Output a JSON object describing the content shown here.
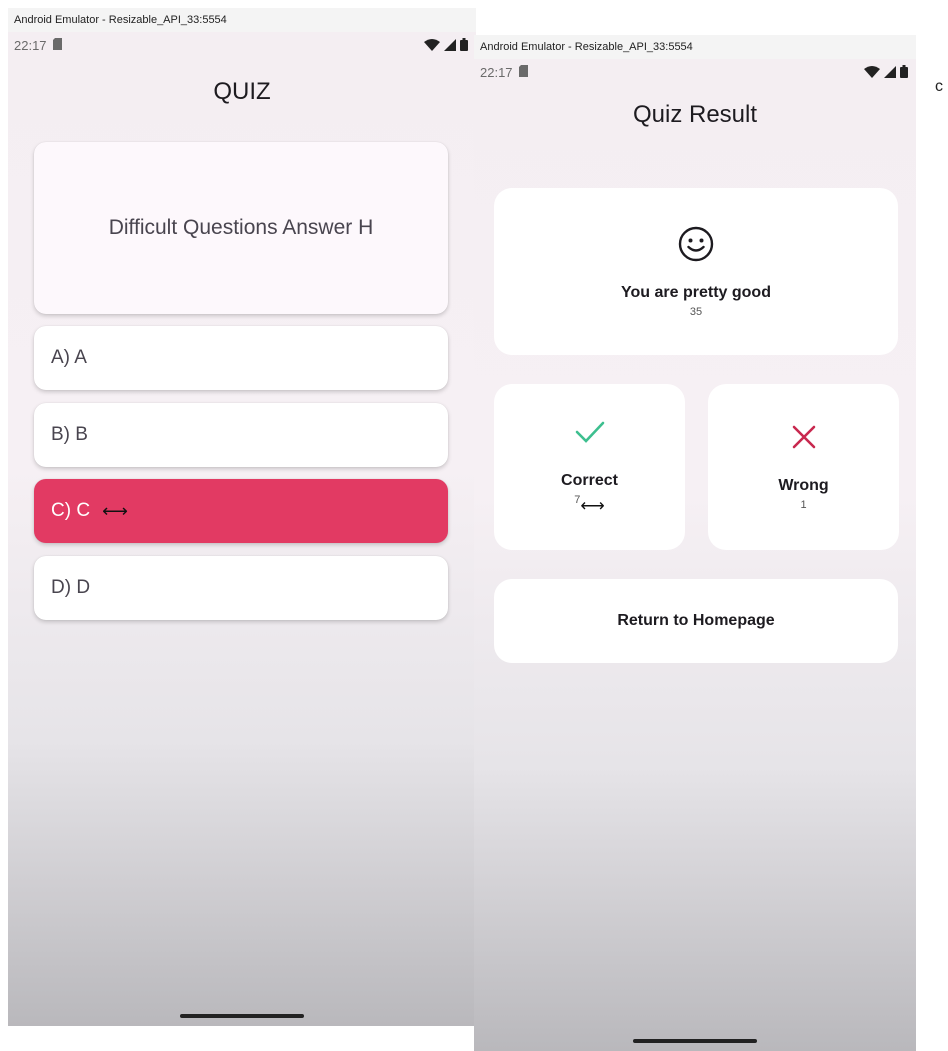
{
  "left_window": {
    "window_title": "Android Emulator - Resizable_API_33:5554",
    "status_time": "22:17",
    "screen_title": "QUIZ",
    "question": "Difficult Questions Answer H",
    "options": [
      {
        "label": "A) A",
        "selected": false
      },
      {
        "label": "B) B",
        "selected": false
      },
      {
        "label": "C) C",
        "selected": true
      },
      {
        "label": "D) D",
        "selected": false
      }
    ],
    "cursor_glyph": "⟷",
    "selected_color": "#e23a63"
  },
  "right_window": {
    "window_title": "Android Emulator - Resizable_API_33:5554",
    "status_time": "22:17",
    "screen_title": "Quiz Result",
    "score_card": {
      "icon": "smiley-face-icon",
      "message": "You are pretty good",
      "score": "35"
    },
    "correct_card": {
      "icon": "check-icon",
      "label": "Correct",
      "count": "7",
      "icon_color": "#3dbf8f"
    },
    "wrong_card": {
      "icon": "close-x-icon",
      "label": "Wrong",
      "count": "1",
      "icon_color": "#c8284e"
    },
    "return_button": {
      "label": "Return to Homepage"
    },
    "cursor_glyph": "⟷"
  },
  "stray_text": "c"
}
